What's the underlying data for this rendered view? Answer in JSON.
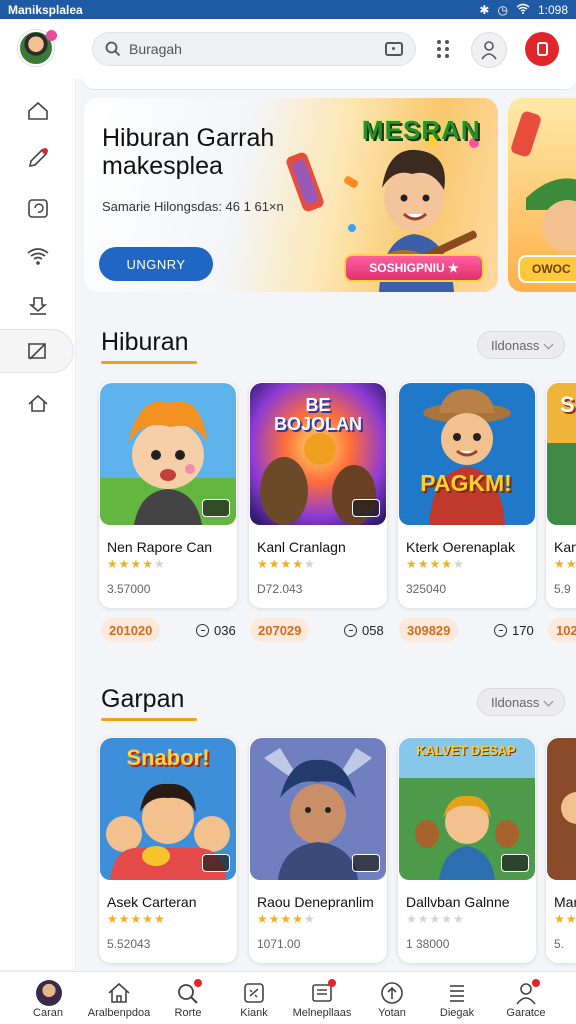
{
  "status_bar": {
    "title": "Maniksplalea",
    "time": "1:098"
  },
  "search": {
    "placeholder": "Buragah"
  },
  "banner": {
    "title": "Hiburan Garrah makesplea",
    "subtitle": "Samarie Hilongsdas: 46 1 61×n",
    "button_label": "UNGNRY",
    "logo_text": "MESRAN",
    "cta_label": "SOSHIGPNIU ★",
    "peek_cta_label": "OWOC"
  },
  "sections": [
    {
      "title": "Hiburan",
      "more_label": "Ildonass",
      "cards": [
        {
          "name": "Nen Rapore Can",
          "rating": 3.5,
          "count": "3.57000",
          "pill": "201020",
          "timer": "036"
        },
        {
          "name": "Kanl Cranlagn",
          "rating": 3.5,
          "count": "D72.043",
          "pill": "207029",
          "timer": "058"
        },
        {
          "name": "Kterk Oerenaplak",
          "rating": 3.5,
          "count": "325040",
          "pill": "309829",
          "timer": "170"
        },
        {
          "name": "Kan",
          "rating": 3.5,
          "count": "5.9",
          "pill": "102",
          "timer": ""
        }
      ]
    },
    {
      "title": "Garpan",
      "more_label": "Ildonass",
      "cards": [
        {
          "name": "Asek Carteran",
          "rating": 5,
          "count": "5.52043",
          "pill": "",
          "timer": ""
        },
        {
          "name": "Raou Denepranlim",
          "rating": 4,
          "count": "1071.00",
          "pill": "",
          "timer": ""
        },
        {
          "name": "Dallvban Galnne",
          "rating": 0,
          "count": "1 38000",
          "pill": "",
          "timer": ""
        },
        {
          "name": "Mar",
          "rating": 5,
          "count": "5.",
          "pill": "",
          "timer": ""
        }
      ]
    }
  ],
  "card_art_titles": {
    "hiburan_2": "BE BOJOLAN",
    "hiburan_3": "PAGKM!",
    "hiburan_4": "S",
    "garpan_1": "Snabor!",
    "garpan_3": "KALVET DESAP"
  },
  "bottom_nav": [
    {
      "label": "Caran",
      "icon": "avatar-icon"
    },
    {
      "label": "Aralbenpdoa",
      "icon": "home-icon"
    },
    {
      "label": "Rorte",
      "icon": "search-icon"
    },
    {
      "label": "Kiank",
      "icon": "gamepad-icon"
    },
    {
      "label": "Melnepllaas",
      "icon": "inbox-icon"
    },
    {
      "label": "Yotan",
      "icon": "upload-icon"
    },
    {
      "label": "Diegak",
      "icon": "list-icon"
    },
    {
      "label": "Garatce",
      "icon": "profile-icon"
    }
  ],
  "colors": {
    "brand": "#1f5aa5",
    "accent": "#f0a020",
    "alert": "#e0262b",
    "button_blue": "#1f67c2"
  }
}
